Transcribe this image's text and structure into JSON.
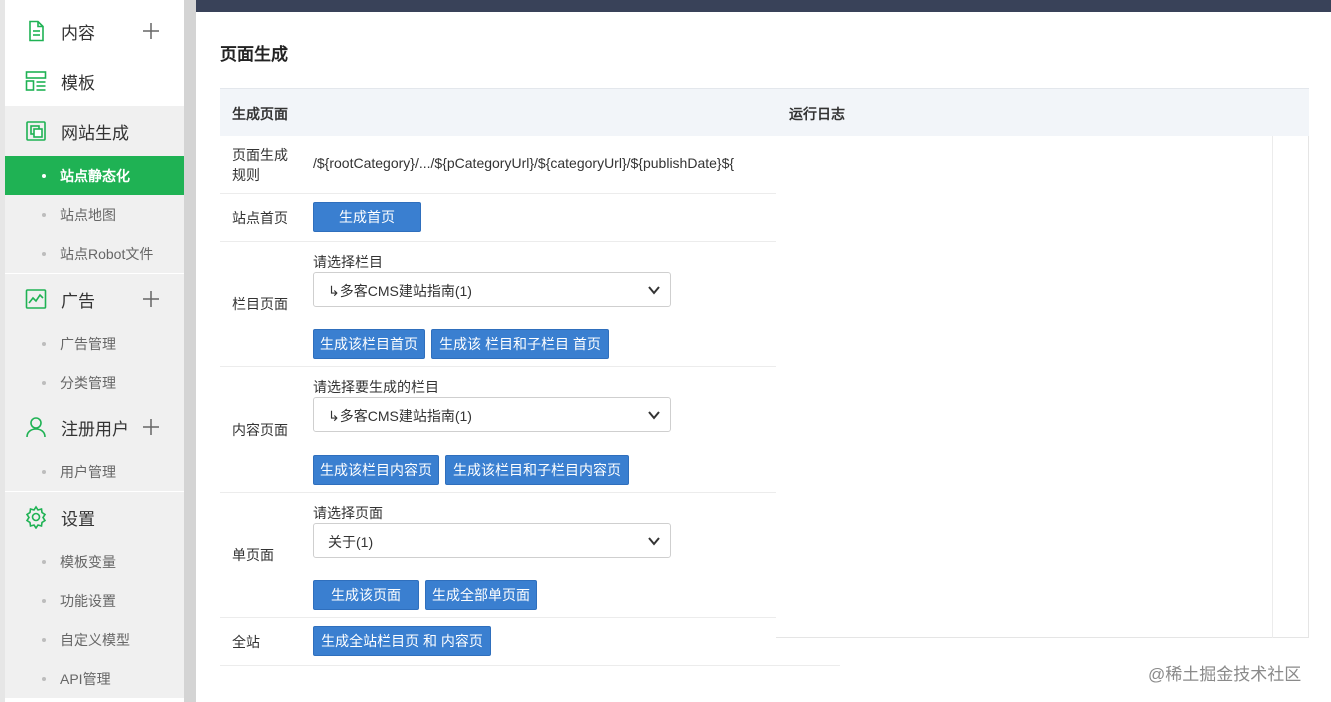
{
  "sidebar": {
    "groups": {
      "content": {
        "label": "内容"
      },
      "template": {
        "label": "模板"
      },
      "site_gen": {
        "label": "网站生成"
      },
      "ads": {
        "label": "广告"
      },
      "users": {
        "label": "注册用户"
      },
      "settings": {
        "label": "设置"
      }
    },
    "items": {
      "site_static": "站点静态化",
      "site_map": "站点地图",
      "site_robot": "站点Robot文件",
      "ad_manage": "广告管理",
      "category_manage": "分类管理",
      "user_manage": "用户管理",
      "template_vars": "模板变量",
      "feature_settings": "功能设置",
      "custom_model": "自定义模型",
      "api_manage": "API管理"
    },
    "accent": "#1fb254"
  },
  "page": {
    "title": "页面生成",
    "col_left": "生成页面",
    "col_right": "运行日志"
  },
  "rows": {
    "rule": {
      "label": "页面生成\n规则",
      "value": "/${rootCategory}/.../${pCategoryUrl}/${categoryUrl}/${publishDate}${"
    },
    "home": {
      "label": "站点首页",
      "btn": "生成首页"
    },
    "category": {
      "label": "栏目页面",
      "caption": "请选择栏目",
      "selected": "↳多客CMS建站指南(1)",
      "btn1": "生成该栏目首页",
      "btn2": "生成该 栏目和子栏目 首页"
    },
    "content": {
      "label": "内容页面",
      "caption": "请选择要生成的栏目",
      "selected": "↳多客CMS建站指南(1)",
      "btn1": "生成该栏目内容页",
      "btn2": "生成该栏目和子栏目内容页"
    },
    "single": {
      "label": "单页面",
      "caption": "请选择页面",
      "selected": "关于(1)",
      "btn1": "生成该页面",
      "btn2": "生成全部单页面"
    },
    "all": {
      "label": "全站",
      "btn": "生成全站栏目页 和 内容页"
    }
  },
  "watermark": "@稀土掘金技术社区",
  "colors": {
    "button": "#3a7fd0",
    "topbar": "#394259"
  }
}
